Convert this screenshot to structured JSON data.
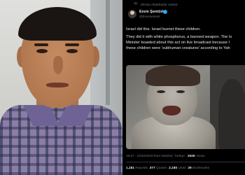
{
  "tweet": {
    "replied_by": "Dilman Abdulkader replied",
    "author_name": "Erem Şentürk",
    "author_handle": "@ErenSenturk",
    "text_lines": [
      "Israel did this. Israel burnet these children.",
      "They did it with white phosphorus, a banned weapon. The Is",
      "Minister boasted about this act on live broadcast because I",
      "these children were 'subhuman creatures' according to Yah"
    ],
    "timestamp": "18:37 · 10/10/2023 from İstanbul, Türkiye",
    "views_count": "253K",
    "views_label": "Views",
    "reposts_count": "1,181",
    "reposts_label": "Reposts",
    "quotes_count": "377",
    "quotes_label": "Quotes",
    "likes_count": "2,180",
    "likes_label": "Likes",
    "bookmarks_count": "29",
    "bookmarks_label": "Bookmarks"
  },
  "icons": {
    "replied": "repost-icon",
    "verified": "verified-badge-icon"
  },
  "colors": {
    "tweet_background": "#000000",
    "verified_blue": "#1d9bf0",
    "muted_text": "#71767b"
  }
}
